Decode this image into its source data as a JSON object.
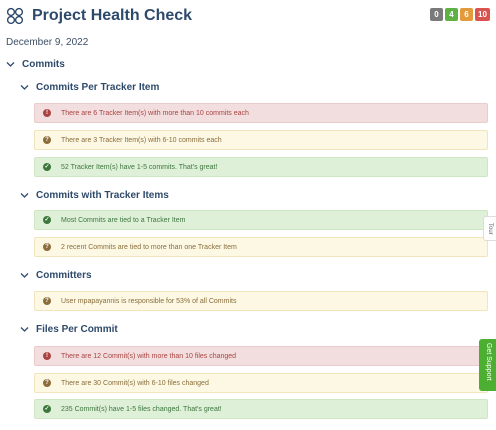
{
  "header": {
    "title": "Project Health Check",
    "counts": {
      "grey": "0",
      "green": "4",
      "orange": "6",
      "red": "10"
    }
  },
  "date": "December 9, 2022",
  "sections": {
    "commits": "Commits",
    "commits_per_tracker": "Commits Per Tracker Item",
    "commits_with_tracker": "Commits with Tracker Items",
    "committers": "Committers",
    "files_per_commit": "Files Per Commit"
  },
  "alerts": {
    "a1": "There are 6 Tracker Item(s) with more than 10 commits each",
    "a2": "There are 3 Tracker Item(s) with 6-10 commits each",
    "a3": "52 Tracker Item(s) have 1-5 commits. That's great!",
    "a4": "Most Commits are tied to a Tracker Item",
    "a5": "2 recent Commits are tied to more than one Tracker Item",
    "a6": "User mpapayannis is responsible for 53% of all Commits",
    "a7": "There are 12 Commit(s) with more than 10 files changed",
    "a8": "There are 30 Commit(s) with 6-10 files changed",
    "a9": "235 Commit(s) have 1-5 files changed. That's great!"
  },
  "icons": {
    "danger": "!",
    "warning": "?",
    "success": "✓"
  },
  "tabs": {
    "tour": "Tour",
    "support": "Get Support"
  },
  "colors": {
    "title": "#2e4a6b",
    "danger": "#a94442",
    "warning": "#8a6d3b",
    "success": "#3c763d",
    "support": "#4caf32"
  }
}
